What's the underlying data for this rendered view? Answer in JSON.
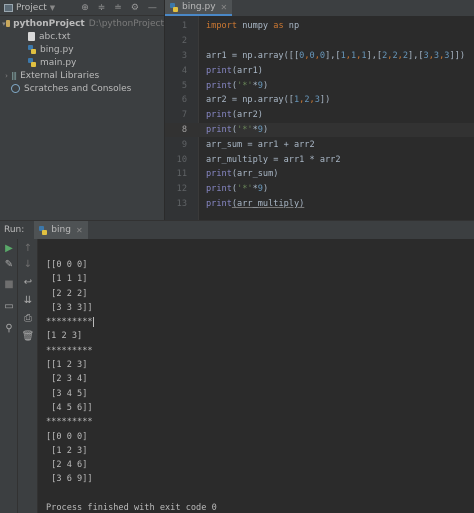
{
  "project_panel": {
    "title": "Project",
    "tree": [
      {
        "label": "pythonProject",
        "path": "D:\\pythonProject",
        "type": "folder",
        "expanded": true
      },
      {
        "label": "abc.txt",
        "type": "txt"
      },
      {
        "label": "bing.py",
        "type": "py"
      },
      {
        "label": "main.py",
        "type": "py"
      },
      {
        "label": "External Libraries",
        "type": "libs"
      },
      {
        "label": "Scratches and Consoles",
        "type": "scratch"
      }
    ]
  },
  "editor": {
    "tab_label": "bing.py",
    "current_line": 8,
    "line_numbers": [
      "1",
      "2",
      "3",
      "4",
      "5",
      "6",
      "7",
      "8",
      "9",
      "10",
      "11",
      "12",
      "13"
    ]
  },
  "code_lines": {
    "l1": {
      "kw1": "import",
      "t1": " numpy ",
      "kw2": "as",
      "t2": " np"
    },
    "l3": {
      "t1": "arr1 = np.array([[",
      "n1": "0",
      "c1": ",",
      "n2": "0",
      "c2": ",",
      "n3": "0",
      "t2": "],[",
      "n4": "1",
      "c3": ",",
      "n5": "1",
      "c4": ",",
      "n6": "1",
      "t3": "],[",
      "n7": "2",
      "c5": ",",
      "n8": "2",
      "c6": ",",
      "n9": "2",
      "t4": "],[",
      "n10": "3",
      "c7": ",",
      "n11": "3",
      "c8": ",",
      "n12": "3",
      "t5": "]])"
    },
    "l4": {
      "fn": "print",
      "t1": "(arr1)"
    },
    "l5": {
      "fn": "print",
      "t1": "(",
      "s1": "'*'",
      "t2": "*",
      "n1": "9",
      "t3": ")"
    },
    "l6": {
      "t1": "arr2 = np.array([",
      "n1": "1",
      "c1": ",",
      "n2": "2",
      "c2": ",",
      "n3": "3",
      "t2": "])"
    },
    "l7": {
      "fn": "print",
      "t1": "(arr2)"
    },
    "l8": {
      "fn": "print",
      "t1": "(",
      "s1": "'*'",
      "t2": "*",
      "n1": "9",
      "t3": ")"
    },
    "l9": {
      "t1": "arr_sum = arr1 + arr2"
    },
    "l10": {
      "t1": "arr_multiply = arr1 * arr2"
    },
    "l11": {
      "fn": "print",
      "t1": "(arr_sum)"
    },
    "l12": {
      "fn": "print",
      "t1": "(",
      "s1": "'*'",
      "t2": "*",
      "n1": "9",
      "t3": ")"
    },
    "l13": {
      "fn": "print",
      "t1": "(arr_multiply)"
    }
  },
  "run_panel": {
    "label": "Run:",
    "tab_label": "bing",
    "console_lines": [
      "[[0 0 0]",
      " [1 1 1]",
      " [2 2 2]",
      " [3 3 3]]",
      "*********",
      "[1 2 3]",
      "*********",
      "[[1 2 3]",
      " [2 3 4]",
      " [3 4 5]",
      " [4 5 6]]",
      "*********",
      "[[0 0 0]",
      " [1 2 3]",
      " [2 4 6]",
      " [3 6 9]]",
      "",
      "Process finished with exit code 0"
    ]
  },
  "colors": {
    "keyword": "#cc7832",
    "number": "#6897bb",
    "string": "#6a8759",
    "builtin": "#8888c6",
    "run_green": "#59a869"
  }
}
